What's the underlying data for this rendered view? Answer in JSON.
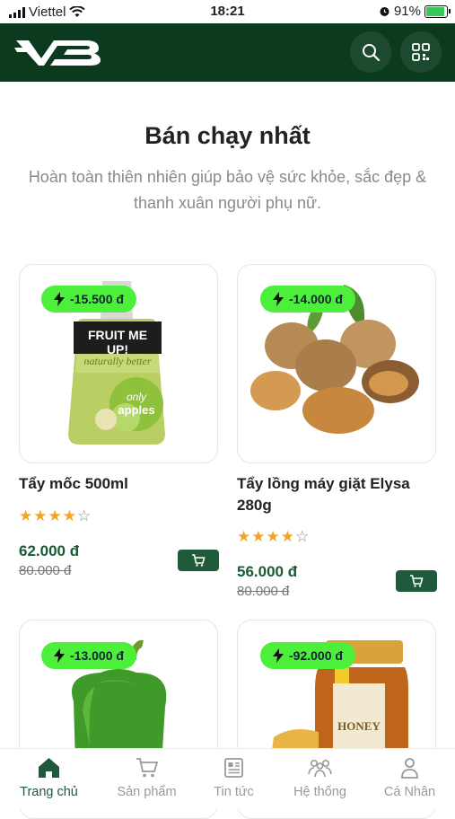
{
  "status_bar": {
    "carrier": "Viettel",
    "time": "18:21",
    "battery": "91%",
    "battery_level": 0.91
  },
  "header": {
    "logo": "VB",
    "icons": [
      "search-icon",
      "qr-code-icon"
    ]
  },
  "section": {
    "title": "Bán chạy nhất",
    "subtitle": "Hoàn toàn thiên nhiên giúp bảo vệ sức khỏe, sắc đẹp & thanh xuân người phụ nữ."
  },
  "products": [
    {
      "discount": "-15.500 đ",
      "name": "Tẩy mốc 500ml",
      "rating": 4,
      "price": "62.000 đ",
      "old_price": "80.000 đ",
      "image": "fruit-pouch",
      "image_text": {
        "brand": "FRUIT ME UP!",
        "tagline": "naturally better",
        "flavor_1": "only",
        "flavor_2": "apples"
      }
    },
    {
      "discount": "-14.000 đ",
      "name": "Tẩy lồng máy giặt Elysa 280g",
      "rating": 4,
      "price": "56.000 đ",
      "old_price": "80.000 đ",
      "image": "walnuts"
    },
    {
      "discount": "-13.000 đ",
      "image": "green-pepper"
    },
    {
      "discount": "-92.000 đ",
      "image": "honey-jar",
      "image_text": {
        "label": "HONEY"
      }
    }
  ],
  "colors": {
    "brand": "#0c3a1e",
    "accent": "#1f5a3a",
    "badge": "#4cf03a",
    "star": "#f2a425"
  },
  "tabbar": [
    {
      "label": "Trang chủ",
      "icon": "home-icon",
      "active": true
    },
    {
      "label": "Sản phẩm",
      "icon": "cart-icon",
      "active": false
    },
    {
      "label": "Tin tức",
      "icon": "news-icon",
      "active": false
    },
    {
      "label": "Hệ thống",
      "icon": "people-icon",
      "active": false
    },
    {
      "label": "Cá Nhân",
      "icon": "user-icon",
      "active": false
    }
  ]
}
